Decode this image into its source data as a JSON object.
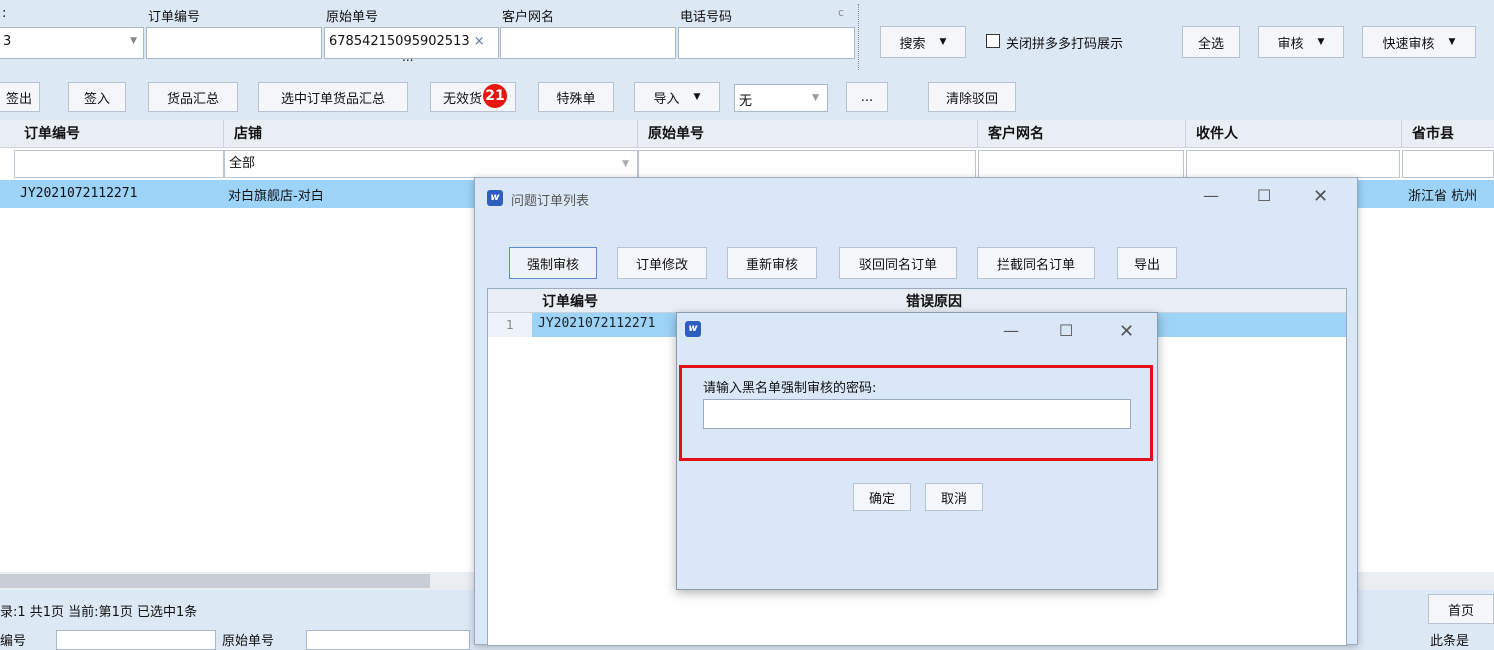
{
  "search": {
    "labels": {
      "partial": ":",
      "order_no": "订单编号",
      "original_no": "原始单号",
      "customer": "客户网名",
      "phone": "电话号码"
    },
    "left_value": "3",
    "original_no_value": "67854215095902513",
    "clear_x": "×",
    "more_dots": "...",
    "small_icon": "c",
    "search_btn": "搜索",
    "close_pdd_label": "关闭拼多多打码展示",
    "select_all_btn": "全选",
    "audit_btn": "审核",
    "quick_audit_btn": "快速审核"
  },
  "toolbar": {
    "sign_out": "签出",
    "sign_in": "签入",
    "goods_summary": "货品汇总",
    "selected_goods_summary": "选中订单货品汇总",
    "invalid_goods": "无效货",
    "invalid_badge": "21",
    "special_order": "特殊单",
    "import": "导入",
    "import_select": "无",
    "more": "...",
    "clear_reject": "清除驳回"
  },
  "grid": {
    "headers": [
      "订单编号",
      "店铺",
      "原始单号",
      "客户网名",
      "收件人",
      "省市县"
    ],
    "filter_shop": "全部",
    "row": {
      "order_no": "JY2021072112271",
      "shop": "对白旗舰店-对白",
      "region": "浙江省 杭州"
    }
  },
  "status": {
    "text": "录:1 共1页 当前:第1页 已选中1条",
    "first_page": "首页"
  },
  "bottom_partial": {
    "label1": "编号",
    "label2": "原始单号",
    "label3": "此条是"
  },
  "problem_dialog": {
    "title": "问题订单列表",
    "buttons": [
      "强制审核",
      "订单修改",
      "重新审核",
      "驳回同名订单",
      "拦截同名订单",
      "导出"
    ],
    "headers": [
      "订单编号",
      "错误原因"
    ],
    "row_index": "1",
    "row_order_no": "JY2021072112271"
  },
  "password_dialog": {
    "prompt": "请输入黑名单强制审核的密码:",
    "confirm": "确定",
    "cancel": "取消"
  },
  "colors": {
    "selected_row": "#9dd3f7",
    "highlight_border": "#e3101a",
    "badge": "#e8170d"
  }
}
